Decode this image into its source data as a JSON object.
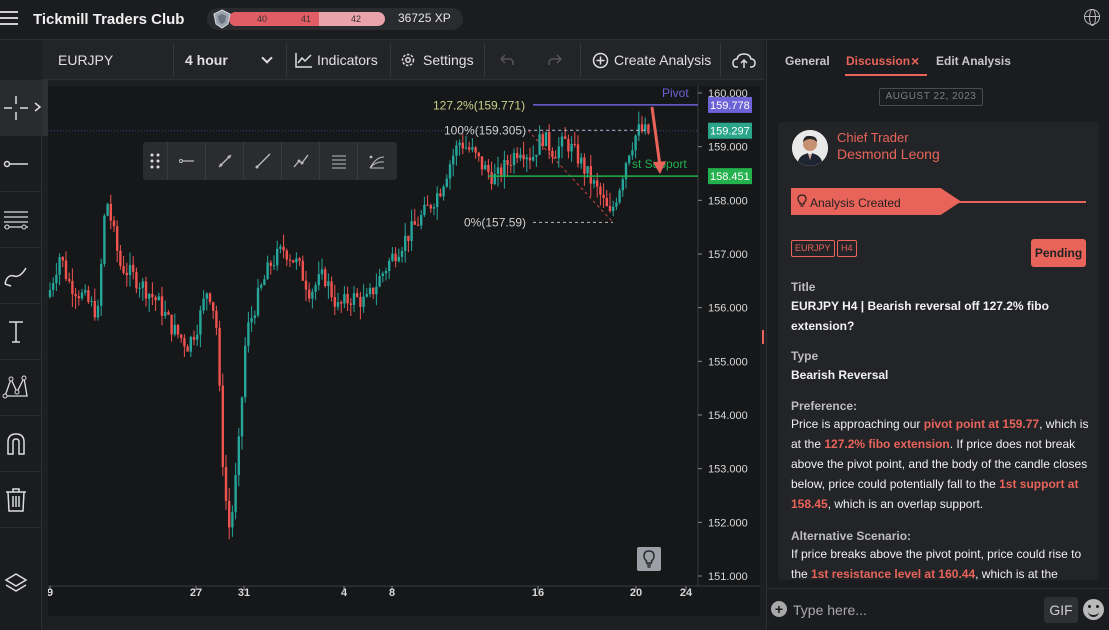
{
  "app": {
    "title": "Tickmill Traders Club"
  },
  "xp": {
    "levels": [
      "40",
      "41",
      "42"
    ],
    "progress": 0.58,
    "total": "36725 XP"
  },
  "toolbar": {
    "symbol": "EURJPY",
    "interval": "4 hour",
    "indicators": "Indicators",
    "settings": "Settings",
    "create_analysis": "Create Analysis"
  },
  "chart_data": {
    "type": "candlestick",
    "symbol": "EURJPY",
    "interval": "4 hour",
    "y_ticks": [
      "160.000",
      "159.000",
      "158.000",
      "157.000",
      "156.000",
      "155.000",
      "154.000",
      "153.000",
      "152.000",
      "151.000"
    ],
    "ylim": [
      151.0,
      160.0
    ],
    "x_ticks": [
      "9",
      "27",
      "31",
      "4",
      "8",
      "16",
      "20",
      "24"
    ],
    "price_labels": [
      {
        "value": "159.778",
        "color": "#6c63d6"
      },
      {
        "value": "159.297",
        "color": "#2ba589"
      },
      {
        "value": "158.451",
        "color": "#23b14d"
      }
    ],
    "annotations": {
      "pivot": "Pivot",
      "fib_127": "127.2%(159.771)",
      "fib_100": "100%(159.305)",
      "fib_0": "0%(157.59)",
      "support": "st Support"
    },
    "levels": {
      "pivot": 159.778,
      "fib_127": 159.771,
      "fib_100": 159.305,
      "fib_0": 157.59,
      "support": 158.451,
      "last": 159.297
    },
    "colors": {
      "up": "#26a69a",
      "down": "#ef5350",
      "pivot_line": "#6c63d6",
      "support_line": "#23b14d",
      "arrow": "#e8645a"
    }
  },
  "panel": {
    "tabs": {
      "general": "General",
      "discussion": "Discussion",
      "close": "×",
      "edit": "Edit Analysis"
    },
    "date": "AUGUST 22, 2023",
    "author": {
      "role": "Chief Trader",
      "name": "Desmond Leong"
    },
    "created": "Analysis Created",
    "tags": [
      "EURJPY",
      "H4"
    ],
    "status": "Pending",
    "title_label": "Title",
    "title": "EURJPY H4 | Bearish reversal off 127.2% fibo extension?",
    "type_label": "Type",
    "type": "Bearish Reversal",
    "preference_label": "Preference:",
    "preference": {
      "t1": "Price is approaching our ",
      "h1": "pivot point at 159.77",
      "t2": ", which is at the ",
      "h2": "127.2% fibo extension",
      "t3": ". If price does not break above the pivot point, and the body of the candle closes below, price could potentially fall to the ",
      "h3": "1st support at 158.45",
      "t4": ", which is an overlap support."
    },
    "alt_label": "Alternative Scenario:",
    "alt": {
      "t1": "If price breaks above the pivot point, price could rise to the ",
      "h1": "1st resistance level at 160.44",
      "t2": ", which is at the"
    },
    "compose_placeholder": "Type here...",
    "gif": "GIF"
  }
}
